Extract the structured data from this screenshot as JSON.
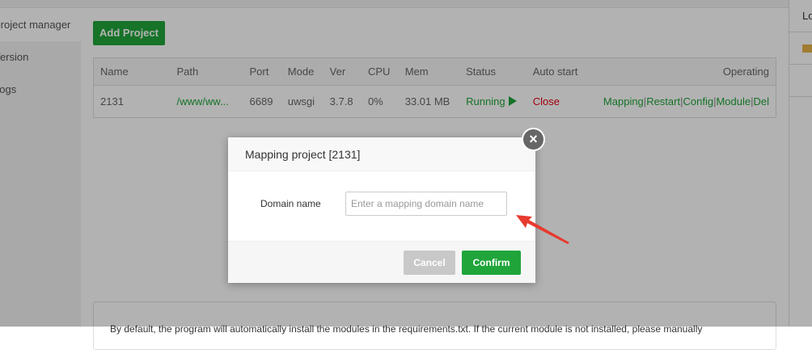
{
  "sidebar": {
    "items": [
      {
        "label": "Project manager"
      },
      {
        "label": "Version"
      },
      {
        "label": "Logs"
      }
    ]
  },
  "toolbar": {
    "add_label": "Add Project"
  },
  "table": {
    "headers": [
      "Name",
      "Path",
      "Port",
      "Mode",
      "Ver",
      "CPU",
      "Mem",
      "Status",
      "Auto start",
      "Operating"
    ],
    "rows": [
      {
        "name": "2131",
        "path": "/www/ww...",
        "port": "6689",
        "mode": "uwsgi",
        "ver": "3.7.8",
        "cpu": "0%",
        "mem": "33.01 MB",
        "status": "Running",
        "auto_start": "Close",
        "ops": [
          "Mapping",
          "Restart",
          "Config",
          "Module",
          "Del"
        ]
      }
    ]
  },
  "note": {
    "text": "By default, the program will automatically install the modules in the requirements.txt. If the current module is not installed, please manually"
  },
  "right_panel": {
    "label": "Lo"
  },
  "modal": {
    "title": "Mapping project [2131]",
    "field_label": "Domain name",
    "placeholder": "Enter a mapping domain name",
    "cancel": "Cancel",
    "confirm": "Confirm"
  },
  "colors": {
    "accent": "#20a53a",
    "danger": "#e60012"
  }
}
